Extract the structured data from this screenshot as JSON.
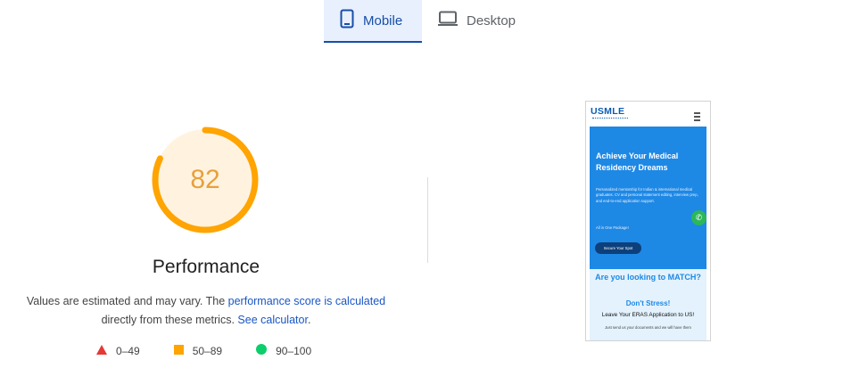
{
  "tabs": [
    {
      "label": "Mobile",
      "icon": "smartphone-icon",
      "active": true
    },
    {
      "label": "Desktop",
      "icon": "desktop-icon",
      "active": false
    }
  ],
  "score": {
    "value": "82",
    "fraction": 0.82,
    "color": "#ffa400",
    "background": "#fff3e0",
    "category": "Performance"
  },
  "description": {
    "text1": "Values are estimated and may vary. The ",
    "link1": "performance score is calculated",
    "text2": "directly from these metrics. ",
    "link2": "See calculator",
    "text3": "."
  },
  "legend": [
    {
      "range": "0–49",
      "shape": "triangle",
      "color": "#e53935"
    },
    {
      "range": "50–89",
      "shape": "square",
      "color": "#ffa400"
    },
    {
      "range": "90–100",
      "shape": "circle",
      "color": "#0cce6b"
    }
  ],
  "preview": {
    "logo": "USMLE",
    "hero_title": "Achieve Your Medical Residency Dreams",
    "hero_text": "Personalized mentorship for Indian & international medical graduates. CV and personal statement editing, interview prep, and end-to-end application support.",
    "hero_text2": "All in One Package!",
    "cta": "Secure Your Spot",
    "question": "Are you looking to MATCH?",
    "dont_stress": "Don't Stress!",
    "eras": "Leave Your ERAS Application to US!",
    "send_text": "Just send us your documents and we will have them"
  }
}
